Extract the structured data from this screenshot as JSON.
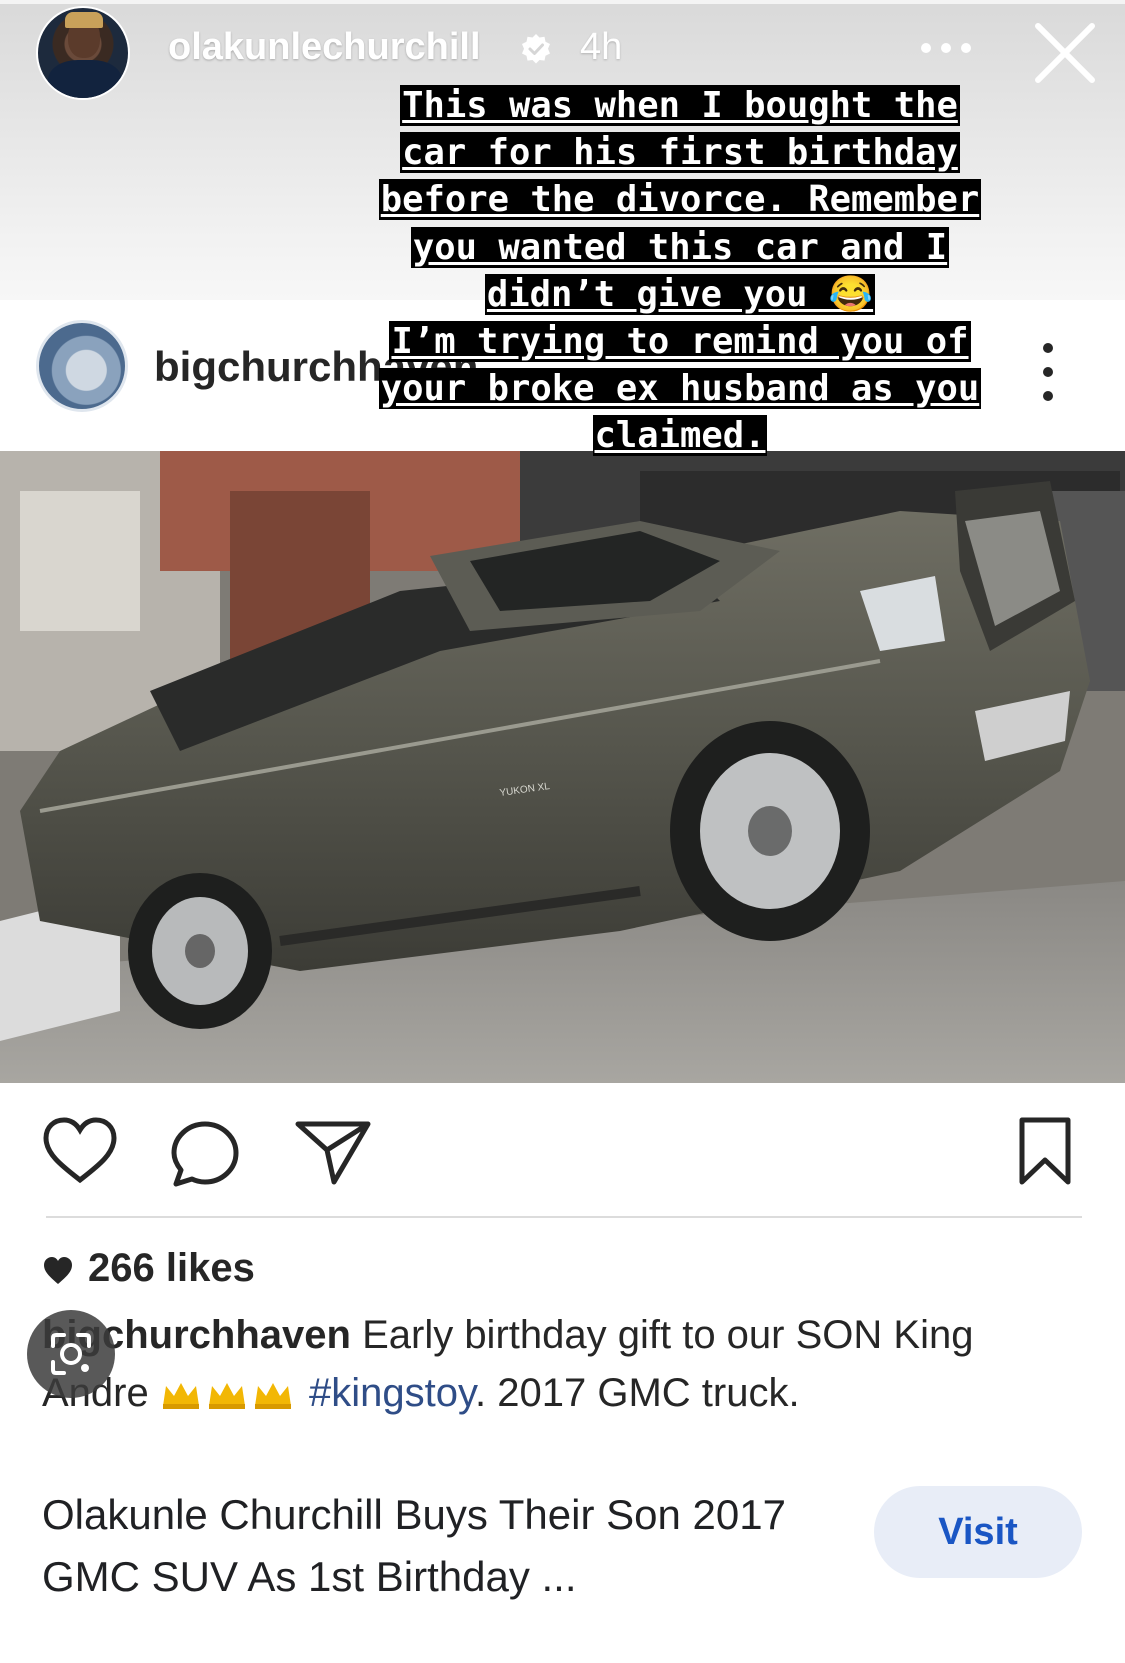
{
  "story": {
    "username": "olakunlechurchill",
    "time": "4h",
    "overlay_lines": [
      "This was when I bought the",
      "car for his first birthday",
      "before the divorce. Remember",
      "you wanted this car and I",
      "didn’t give you 😂",
      "I’m trying to remind you of",
      "your broke ex husband as you",
      "claimed."
    ]
  },
  "post": {
    "username": "bigchurchhaven",
    "likes": "266 likes",
    "caption": {
      "user": "bigchurchhaven",
      "text_before": " Early birthday gift to our SON King Andre ",
      "hashtag": "#kingstoy",
      "text_after": ". 2017 GMC truck."
    },
    "photo_text": "YUKON XL"
  },
  "link": {
    "title": "Olakunle Churchill Buys Their Son 2017 GMC SUV As 1st Birthday ...",
    "button": "Visit"
  }
}
